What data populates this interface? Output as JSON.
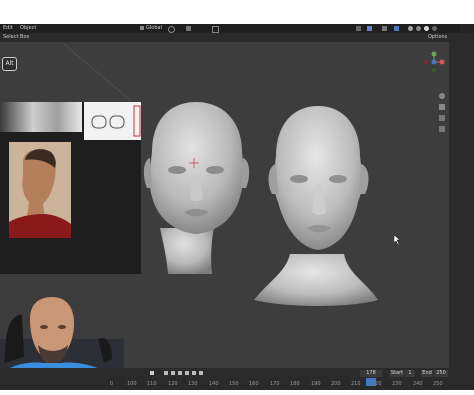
{
  "top_menu": {
    "left_items": [
      "Edit",
      "Object"
    ],
    "select_label": "Select Box",
    "transform": "Global",
    "options": "Options"
  },
  "overlay": {
    "key_label": "Alt"
  },
  "timeline": {
    "ticks": [
      "0",
      "100",
      "110",
      "120",
      "130",
      "140",
      "150",
      "160",
      "170",
      "180",
      "190",
      "200",
      "210",
      "220",
      "230",
      "240",
      "250"
    ],
    "current_frame": "178",
    "start_label": "Start",
    "start_value": "1",
    "end_label": "End",
    "end_value": "250"
  },
  "colors": {
    "viewport": "#3d3d3d",
    "header": "#2a2a2a",
    "webcam_bg": "#2c3e70",
    "shirt": "#3a8ee0"
  }
}
